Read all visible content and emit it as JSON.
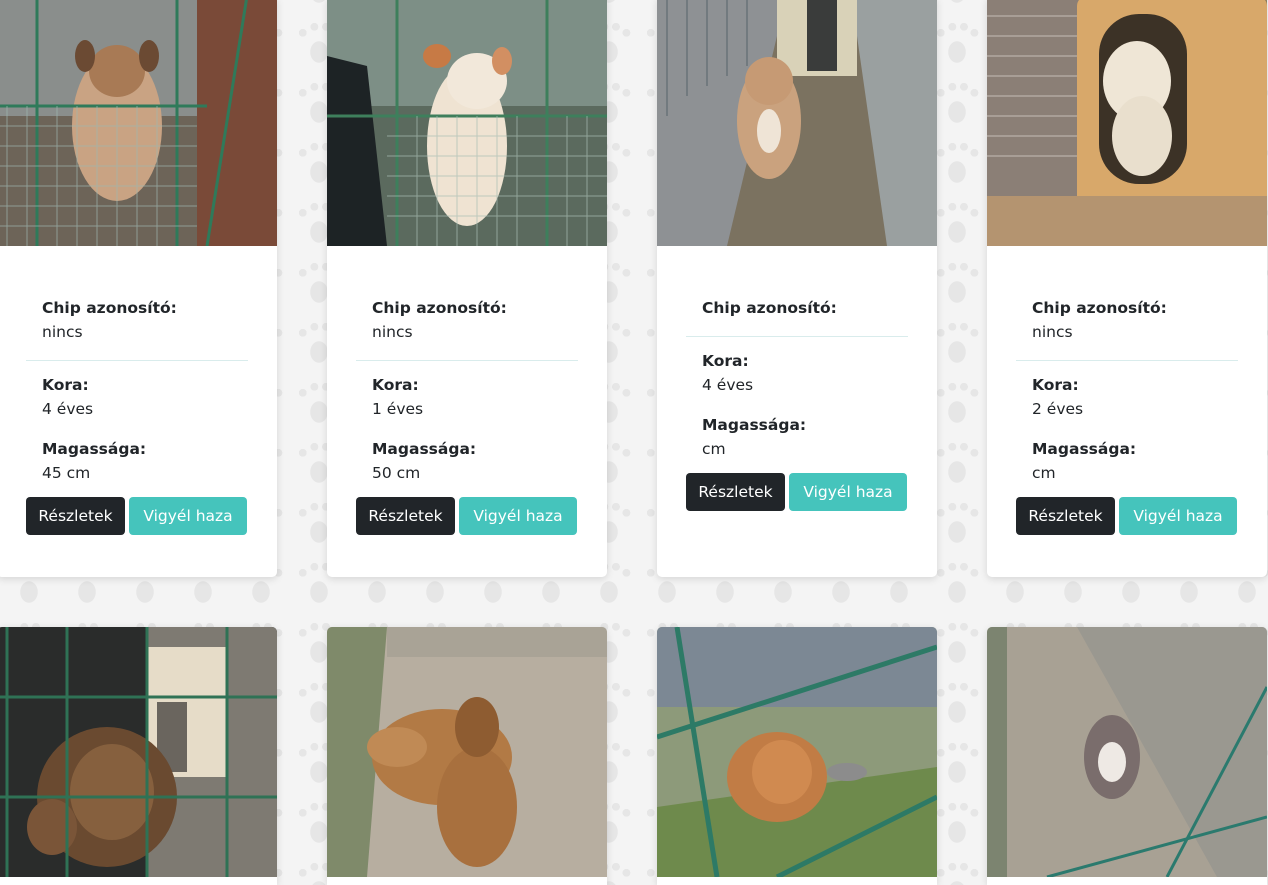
{
  "cards": [
    {
      "chip_label": "Chip azonosító:",
      "chip_value": "nincs",
      "age_label": "Kora:",
      "age_value": "4 éves",
      "height_label": "Magassága:",
      "height_value": "45 cm",
      "details_label": "Részletek",
      "adopt_label": "Vigyél haza"
    },
    {
      "chip_label": "Chip azonosító:",
      "chip_value": "nincs",
      "age_label": "Kora:",
      "age_value": "1 éves",
      "height_label": "Magassága:",
      "height_value": "50 cm",
      "details_label": "Részletek",
      "adopt_label": "Vigyél haza"
    },
    {
      "chip_label": "Chip azonosító:",
      "chip_value": "",
      "age_label": "Kora:",
      "age_value": "4 éves",
      "height_label": "Magassága:",
      "height_value": "cm",
      "details_label": "Részletek",
      "adopt_label": "Vigyél haza"
    },
    {
      "chip_label": "Chip azonosító:",
      "chip_value": "nincs",
      "age_label": "Kora:",
      "age_value": "2 éves",
      "height_label": "Magassága:",
      "height_value": "cm",
      "details_label": "Részletek",
      "adopt_label": "Vigyél haza"
    }
  ],
  "colors": {
    "dark_button": "#212529",
    "teal_button": "#45c4bc",
    "background": "#f4f4f4"
  }
}
